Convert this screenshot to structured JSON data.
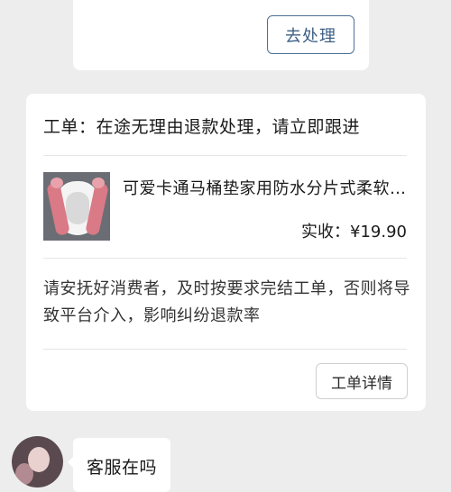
{
  "top_card": {
    "process_button_label": "去处理"
  },
  "work_order": {
    "title": "工单：在途无理由退款处理，请立即跟进",
    "product": {
      "thumbnail_icon": "toilet-seat-cover-product-image",
      "name": "可爱卡通马桶垫家用防水分片式柔软…",
      "price_label": "实收：",
      "price_value": "¥19.90"
    },
    "notice": "请安抚好消费者，及时按要求完结工单，否则将导致平台介入，影响纠纷退款率",
    "detail_button_label": "工单详情"
  },
  "chat": {
    "avatar_icon": "user-avatar",
    "message": "客服在吗"
  },
  "colors": {
    "background": "#ededed",
    "card": "#ffffff",
    "accent_button_border": "#4c6f93",
    "accent_button_text": "#3e5f84"
  }
}
